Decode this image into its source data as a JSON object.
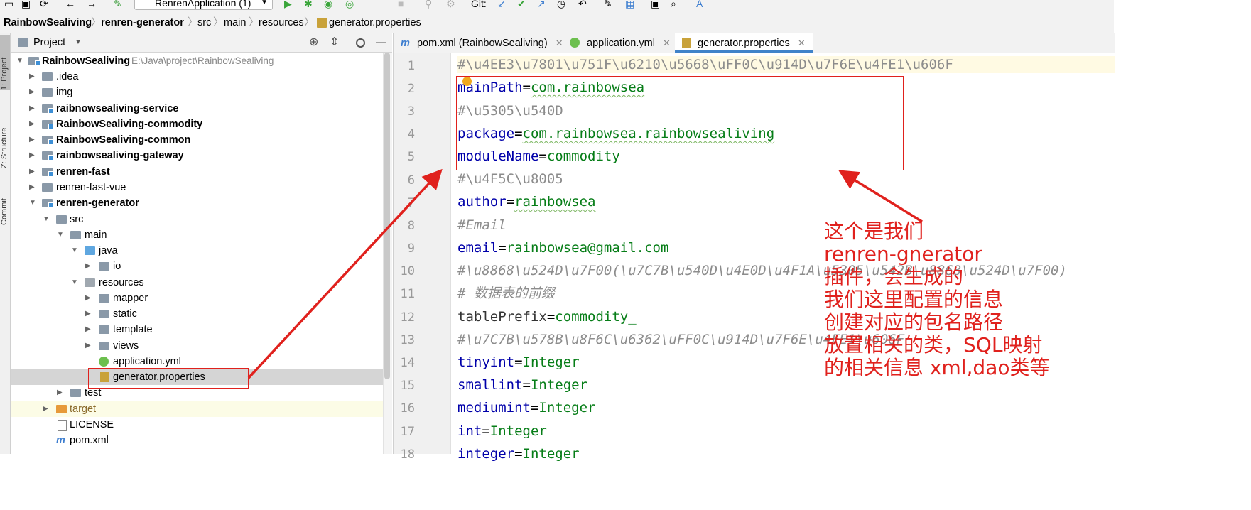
{
  "toolbar": {
    "run_config": "RenrenApplication (1)",
    "git_label": "Git:"
  },
  "breadcrumbs": [
    "RainbowSealiving",
    "renren-generator",
    "src",
    "main",
    "resources",
    "generator.properties"
  ],
  "left_strip": {
    "project": "1: Project",
    "structure": "Z: Structure",
    "commit": "Commit"
  },
  "project_panel": {
    "title": "Project",
    "root_name": "RainbowSealiving",
    "root_path": "E:\\Java\\project\\RainbowSealiving",
    "items": [
      {
        "label": ".idea"
      },
      {
        "label": "img"
      },
      {
        "label": "raibnowsealiving-service"
      },
      {
        "label": "RainbowSealiving-commodity"
      },
      {
        "label": "RainbowSealiving-common"
      },
      {
        "label": "rainbowsealiving-gateway"
      },
      {
        "label": "renren-fast"
      },
      {
        "label": "renren-fast-vue"
      },
      {
        "label": "renren-generator"
      },
      {
        "label": "src"
      },
      {
        "label": "main"
      },
      {
        "label": "java"
      },
      {
        "label": "io"
      },
      {
        "label": "resources"
      },
      {
        "label": "mapper"
      },
      {
        "label": "static"
      },
      {
        "label": "template"
      },
      {
        "label": "views"
      },
      {
        "label": "application.yml"
      },
      {
        "label": "generator.properties"
      },
      {
        "label": "test"
      },
      {
        "label": "target"
      },
      {
        "label": "LICENSE"
      },
      {
        "label": "pom.xml"
      }
    ]
  },
  "editor": {
    "tabs": [
      {
        "label": "pom.xml (RainbowSealiving)"
      },
      {
        "label": "application.yml"
      },
      {
        "label": "generator.properties"
      }
    ],
    "line_numbers": [
      "1",
      "2",
      "3",
      "4",
      "5",
      "6",
      "7",
      "8",
      "9",
      "10",
      "11",
      "12",
      "13",
      "14",
      "15",
      "16",
      "17",
      "18"
    ],
    "lines": [
      {
        "text": "#\\u4EE3\\u7801\\u751F\\u6210\\u5668\\uFF0C\\u914D\\u7F6E\\u4FE1\\u606F"
      },
      {
        "key": "mainPath",
        "value": "com.rainbowsea"
      },
      {
        "text": "#\\u5305\\u540D"
      },
      {
        "key": "package",
        "value": "com.rainbowsea.rainbowsealiving"
      },
      {
        "key": "moduleName",
        "value": "commodity"
      },
      {
        "text": "#\\u4F5C\\u8005"
      },
      {
        "key": "author",
        "value": "rainbowsea"
      },
      {
        "text": "#Email"
      },
      {
        "key": "email",
        "value": "rainbowsea@gmail.com"
      },
      {
        "text": "#\\u8868\\u524D\\u7F00(\\u7C7B\\u540D\\u4E0D\\u4F1A\\u5305\\u542B\\u8868\\u524D\\u7F00)"
      },
      {
        "text": "# 数据表的前缀"
      },
      {
        "key": "tablePrefix",
        "value": "commodity_"
      },
      {
        "text": "#\\u7C7B\\u578B\\u8F6C\\u6362\\uFF0C\\u914D\\u7F6E\\u4FE1\\u606F"
      },
      {
        "key": "tinyint",
        "value": "Integer"
      },
      {
        "key": "smallint",
        "value": "Integer"
      },
      {
        "key": "mediumint",
        "value": "Integer"
      },
      {
        "key": "int",
        "value": "Integer"
      },
      {
        "key": "integer",
        "value": "Integer"
      }
    ]
  },
  "annotation": {
    "lines": [
      "这个是我们",
      "renren-gnerator",
      "插件，会生成的",
      "我们这里配置的信息",
      "创建对应的包名路径",
      "放置相关的类，SQL映射",
      "的相关信息 xml,dao类等"
    ]
  },
  "colors": {
    "annotation": "#e0211d",
    "key": "#0000aa",
    "value": "#067d17",
    "comment": "#8c8c8c"
  }
}
